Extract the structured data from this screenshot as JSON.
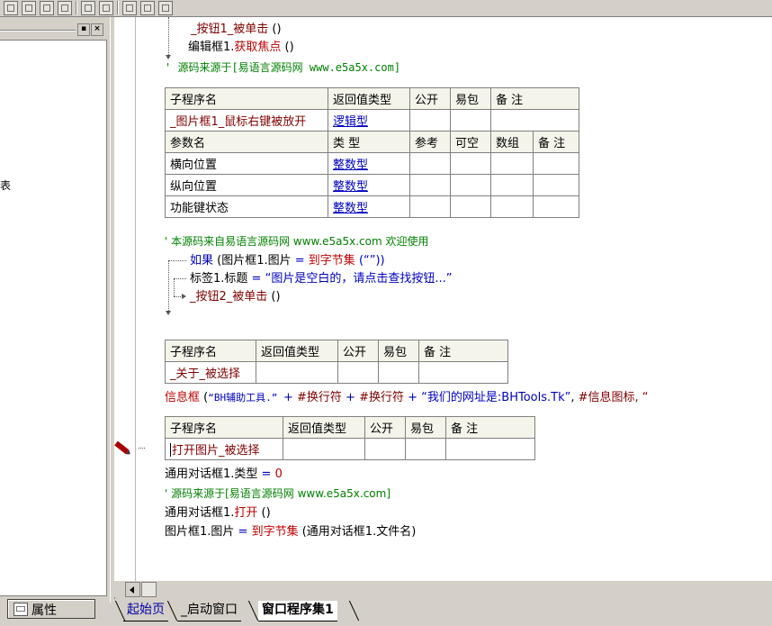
{
  "left_panel": {
    "edge_char": "表",
    "property_tab_label": "属性"
  },
  "editor": {
    "code_top": [
      {
        "parts": [
          {
            "t": "_按钮1_被单击",
            "c": "kw-maroon"
          },
          {
            "t": " ()",
            "c": ""
          }
        ]
      },
      {
        "parts": [
          {
            "t": "编辑框1.",
            "c": ""
          },
          {
            "t": "获取焦点",
            "c": "kw-red"
          },
          {
            "t": " ()",
            "c": ""
          }
        ]
      },
      {
        "parts": [
          {
            "t": "' 源码来源于[易语言源码网 www.e5a5x.com]",
            "c": "kw-green"
          }
        ]
      }
    ],
    "table1": {
      "header": [
        "子程序名",
        "返回值类型",
        "公开",
        "易包",
        "备 注"
      ],
      "row": [
        "_图片框1_鼠标右键被放开",
        "逻辑型",
        "",
        "",
        ""
      ],
      "param_header": [
        "参数名",
        "类 型",
        "参考",
        "可空",
        "数组",
        "备 注"
      ],
      "params": [
        [
          "横向位置",
          "整数型",
          "",
          "",
          "",
          ""
        ],
        [
          "纵向位置",
          "整数型",
          "",
          "",
          "",
          ""
        ],
        [
          "功能键状态",
          "整数型",
          "",
          "",
          "",
          ""
        ]
      ]
    },
    "code_mid": {
      "comment": "' 本源码来自易语言源码网 www.e5a5x.com  欢迎使用",
      "if_kw": "如果",
      "if_open": " (图片框1.图片 ",
      "if_eq": "=",
      "if_func": " 到字节集",
      "if_str": " (“”))",
      "label_line": "标签1.标题 ",
      "label_eq": "=",
      "label_str": " “图片是空白的，请点击查找按钮...”",
      "call_line": "_按钮2_被单击",
      "call_paren": " ()"
    },
    "table2": {
      "header": [
        "子程序名",
        "返回值类型",
        "公开",
        "易包",
        "备 注"
      ],
      "row": [
        "_关于_被选择",
        "",
        "",
        "",
        ""
      ]
    },
    "msgbox_line": {
      "func": "信息框",
      "rest_open": " (",
      "str1": "“BH辅助工具.” ",
      "plus1": "+ ",
      "const1": "#换行符",
      "plus2": " + ",
      "const2": "#换行符",
      "plus3": " + ",
      "str2": "“我们的网址是:BHTools.Tk”",
      "comma": ", ",
      "const3": "#信息图标, “"
    },
    "table3": {
      "header": [
        "子程序名",
        "返回值类型",
        "公开",
        "易包",
        "备 注"
      ],
      "row": [
        "打开图片_被选择",
        "",
        "",
        "",
        ""
      ]
    },
    "code_bottom": {
      "l1_obj": "通用对话框1.类型 ",
      "l1_eq": "=",
      "l1_val": " 0",
      "l2": "' 源码来源于[易语言源码网 www.e5a5x.com]",
      "l3_obj": "通用对话框1.",
      "l3_method": "打开",
      "l3_paren": " ()",
      "l4_obj": "图片框1.图片 ",
      "l4_eq": "=",
      "l4_func": " 到字节集",
      "l4_rest": " (通用对话框1.文件名)"
    }
  },
  "tabs": [
    {
      "label": "起始页"
    },
    {
      "label": "_启动窗口"
    },
    {
      "label": "窗口程序集1"
    }
  ]
}
